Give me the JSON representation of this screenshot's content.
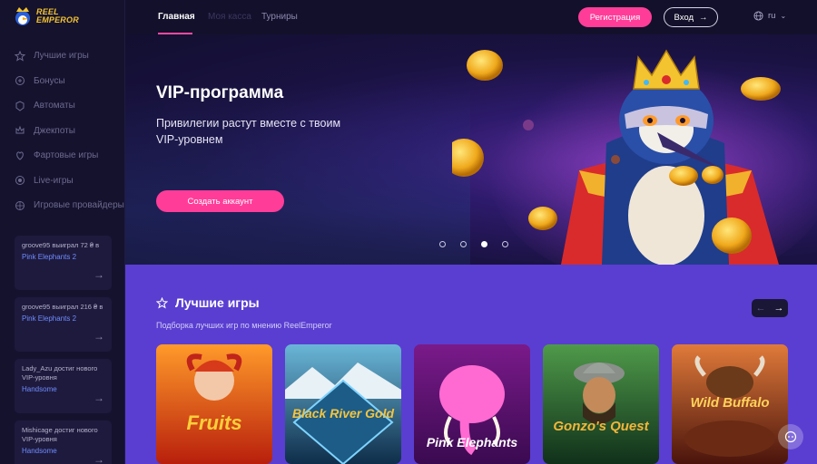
{
  "logo": {
    "line1": "REEL",
    "line2": "EMPEROR"
  },
  "sidebar": {
    "items": [
      {
        "label": "Лучшие игры",
        "icon": "star-icon"
      },
      {
        "label": "Бонусы",
        "icon": "bonus-icon"
      },
      {
        "label": "Автоматы",
        "icon": "slots-icon"
      },
      {
        "label": "Джекпоты",
        "icon": "jackpot-icon"
      },
      {
        "label": "Фартовые игры",
        "icon": "luck-icon"
      },
      {
        "label": "Live-игры",
        "icon": "live-icon"
      },
      {
        "label": "Игровые провайдеры",
        "icon": "providers-icon"
      }
    ],
    "feed": [
      {
        "who": "groove95 выиграл 72 ₴ в",
        "game": "Pink Elephants 2"
      },
      {
        "who": "groove95 выиграл 216 ₴ в",
        "game": "Pink Elephants 2"
      },
      {
        "who": "Lady_Azu достиг нового VIP-уровня",
        "game": "Handsome"
      },
      {
        "who": "Mishicage достиг нового VIP-уровня",
        "game": "Handsome"
      }
    ]
  },
  "topbar": {
    "tabs": [
      "Главная",
      "Моя касса",
      "Турниры"
    ],
    "register": "Регистрация",
    "login": "Вход",
    "lang": "ru"
  },
  "hero": {
    "title": "VIP-программа",
    "subtitle": "Привилегии растут вместе с твоим VIP-уровнем",
    "cta": "Создать аккаунт",
    "slides": 4,
    "active_slide": 3
  },
  "games": {
    "title": "Лучшие игры",
    "subtitle": "Подборка лучших игр по мнению ReelEmperor",
    "tiles": [
      {
        "name": "Fruits",
        "bg1": "#ff7a1a",
        "bg2": "#b81f0c",
        "text": "#ffcf3a"
      },
      {
        "name": "Black River Gold",
        "bg1": "#2f7fa6",
        "bg2": "#0e2d4a",
        "text": "#f3c440"
      },
      {
        "name": "Pink Elephants",
        "bg1": "#ff56c8",
        "bg2": "#6a1080",
        "text": "#ffffff"
      },
      {
        "name": "Gonzo's Quest",
        "bg1": "#3b8a3c",
        "bg2": "#10301a",
        "text": "#f2b63a"
      },
      {
        "name": "Wild Buffalo",
        "bg1": "#c94a1a",
        "bg2": "#4a140c",
        "text": "#ffd25a"
      }
    ]
  },
  "colors": {
    "accent": "#ff3d99",
    "section": "#5a3ed1",
    "sidebar": "#15122e"
  }
}
